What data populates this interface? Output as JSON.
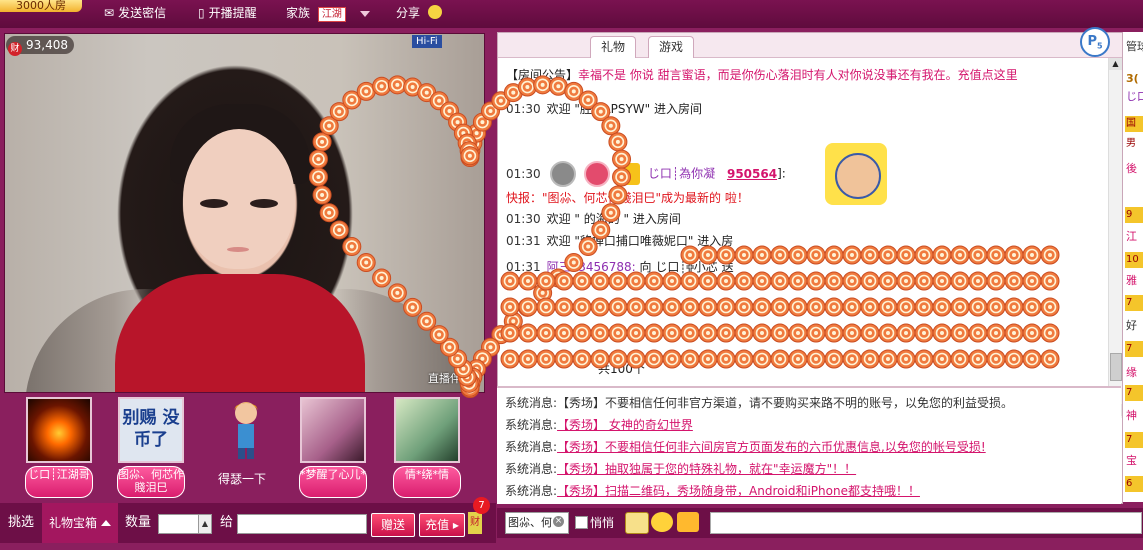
{
  "topbar": {
    "room_count": "3000人房",
    "send_private": "发送密信",
    "broadcast_alert": "开播提醒",
    "family": "家族",
    "family_tag": "江湖",
    "share": "分享"
  },
  "video": {
    "wealth_value": "93,408",
    "wealth_icon_char": "财",
    "hifi": "Hi-Fi",
    "watermark": "直播伴侣"
  },
  "gifts": [
    {
      "label": "じ口┊江湖哥"
    },
    {
      "label": "图尛、何芯作賤泪巳",
      "image_text": "别赐 没币了"
    },
    {
      "label": "得瑟一下"
    },
    {
      "label": "*梦醒了心儿*"
    },
    {
      "label": "情*绕*情"
    }
  ],
  "gift_bar": {
    "pick": "挑选",
    "gift_box": "礼物宝箱",
    "quantity": "数量",
    "to": "给",
    "send": "赠送",
    "recharge": "充值",
    "badge_count": "7",
    "wealth_mini": "财"
  },
  "chat": {
    "tabs": [
      "礼物",
      "游戏"
    ],
    "p_badge": "P",
    "p_badge_sub": "5",
    "announcement_label": "【房间公告】",
    "announcement_text": "幸福不是    你说    甜言蜜语，而是你伤心落泪时有人对你说没事还有我在。充值点这里",
    "messages": [
      {
        "time": "01:30",
        "text": "欢迎 \"胜利LPSYW\" 进入房间"
      },
      {
        "time": "01:30",
        "user": "じ口┊為你凝",
        "user_id": "950564",
        "suffix": "]:"
      },
      {
        "text": "快报：\"图尛、何芯作賤泪巳\"成为最新的       啦！"
      },
      {
        "time": "01:30",
        "text": "欢迎 \"   的海的     \" 进入房间"
      },
      {
        "time": "01:31",
        "text": "欢迎 \"貉蝉口捕口唯薇妮口\" 进入房"
      },
      {
        "time": "01:31",
        "user": "阿三13456788:",
        "text": "向 じ口┊╬小芯        送"
      },
      {
        "text": "         共100个"
      }
    ]
  },
  "system": {
    "label": "系统消息:",
    "messages": [
      "【秀场】不要相信任何非官方渠道，请不要购买来路不明的账号，以免您的利益受损。",
      "【秀场】      女神的奇幻世界",
      "【秀场】不要相信任何非六间房官方页面发布的六币优惠信息,以免您的帐号受损!",
      "【秀场】抽取独属于您的特殊礼物，就在\"幸运魔方\"！！",
      "【秀场】扫描二维码，秀场随身带，Android和iPhone都支持哦！！"
    ]
  },
  "input": {
    "target": "图尛、何",
    "whisper": "悄悄"
  },
  "right_col": {
    "title": "管球",
    "items": [
      "3(",
      "じ口",
      "国",
      "男",
      "後",
      "9",
      "江",
      "10",
      "雅",
      "7",
      "好",
      "7",
      "缘",
      "7",
      "神",
      "7",
      "宝",
      "6"
    ]
  },
  "colors": {
    "brand": "#8a1f5e",
    "accent_pink": "#d4146c",
    "lollipop": "#e8643a"
  }
}
